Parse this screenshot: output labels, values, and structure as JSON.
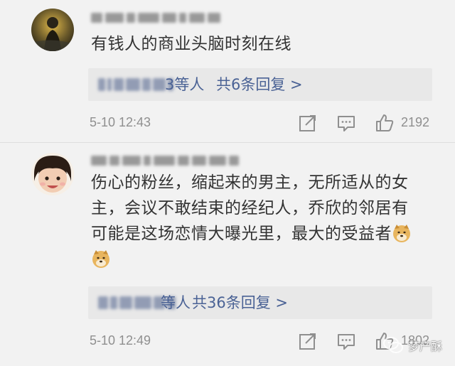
{
  "comments": [
    {
      "username": "",
      "text_lines": [
        "有钱人的商业头脑时刻在线"
      ],
      "replies": {
        "names_suffix": "3等人",
        "count_label": "共6条回复 >"
      },
      "timestamp": "5-10 12:43",
      "likes": "2192"
    },
    {
      "username": "",
      "text_lines": [
        "伤心的粉丝，缩起来的男主，无所适从的女",
        "主，会议不敢结束的经纪人，乔欣的邻居有",
        "可能是这场恋情大曝光里，最大的受益者"
      ],
      "replies": {
        "names_prefix": "",
        "names_suffix": "等人",
        "count_label": "共36条回复 >"
      },
      "timestamp": "5-10 12:49",
      "likes": "1802"
    }
  ],
  "icons": {
    "share": "share-icon",
    "comment": "comment-icon",
    "like": "thumbs-up-icon",
    "emoji": "doge-emoji-icon"
  },
  "colors": {
    "background": "#f2f2f2",
    "reply_box": "#e8e8e8",
    "link": "#4a6295",
    "meta": "#8f8f8f"
  },
  "watermark": {
    "text": "梦产酥"
  }
}
